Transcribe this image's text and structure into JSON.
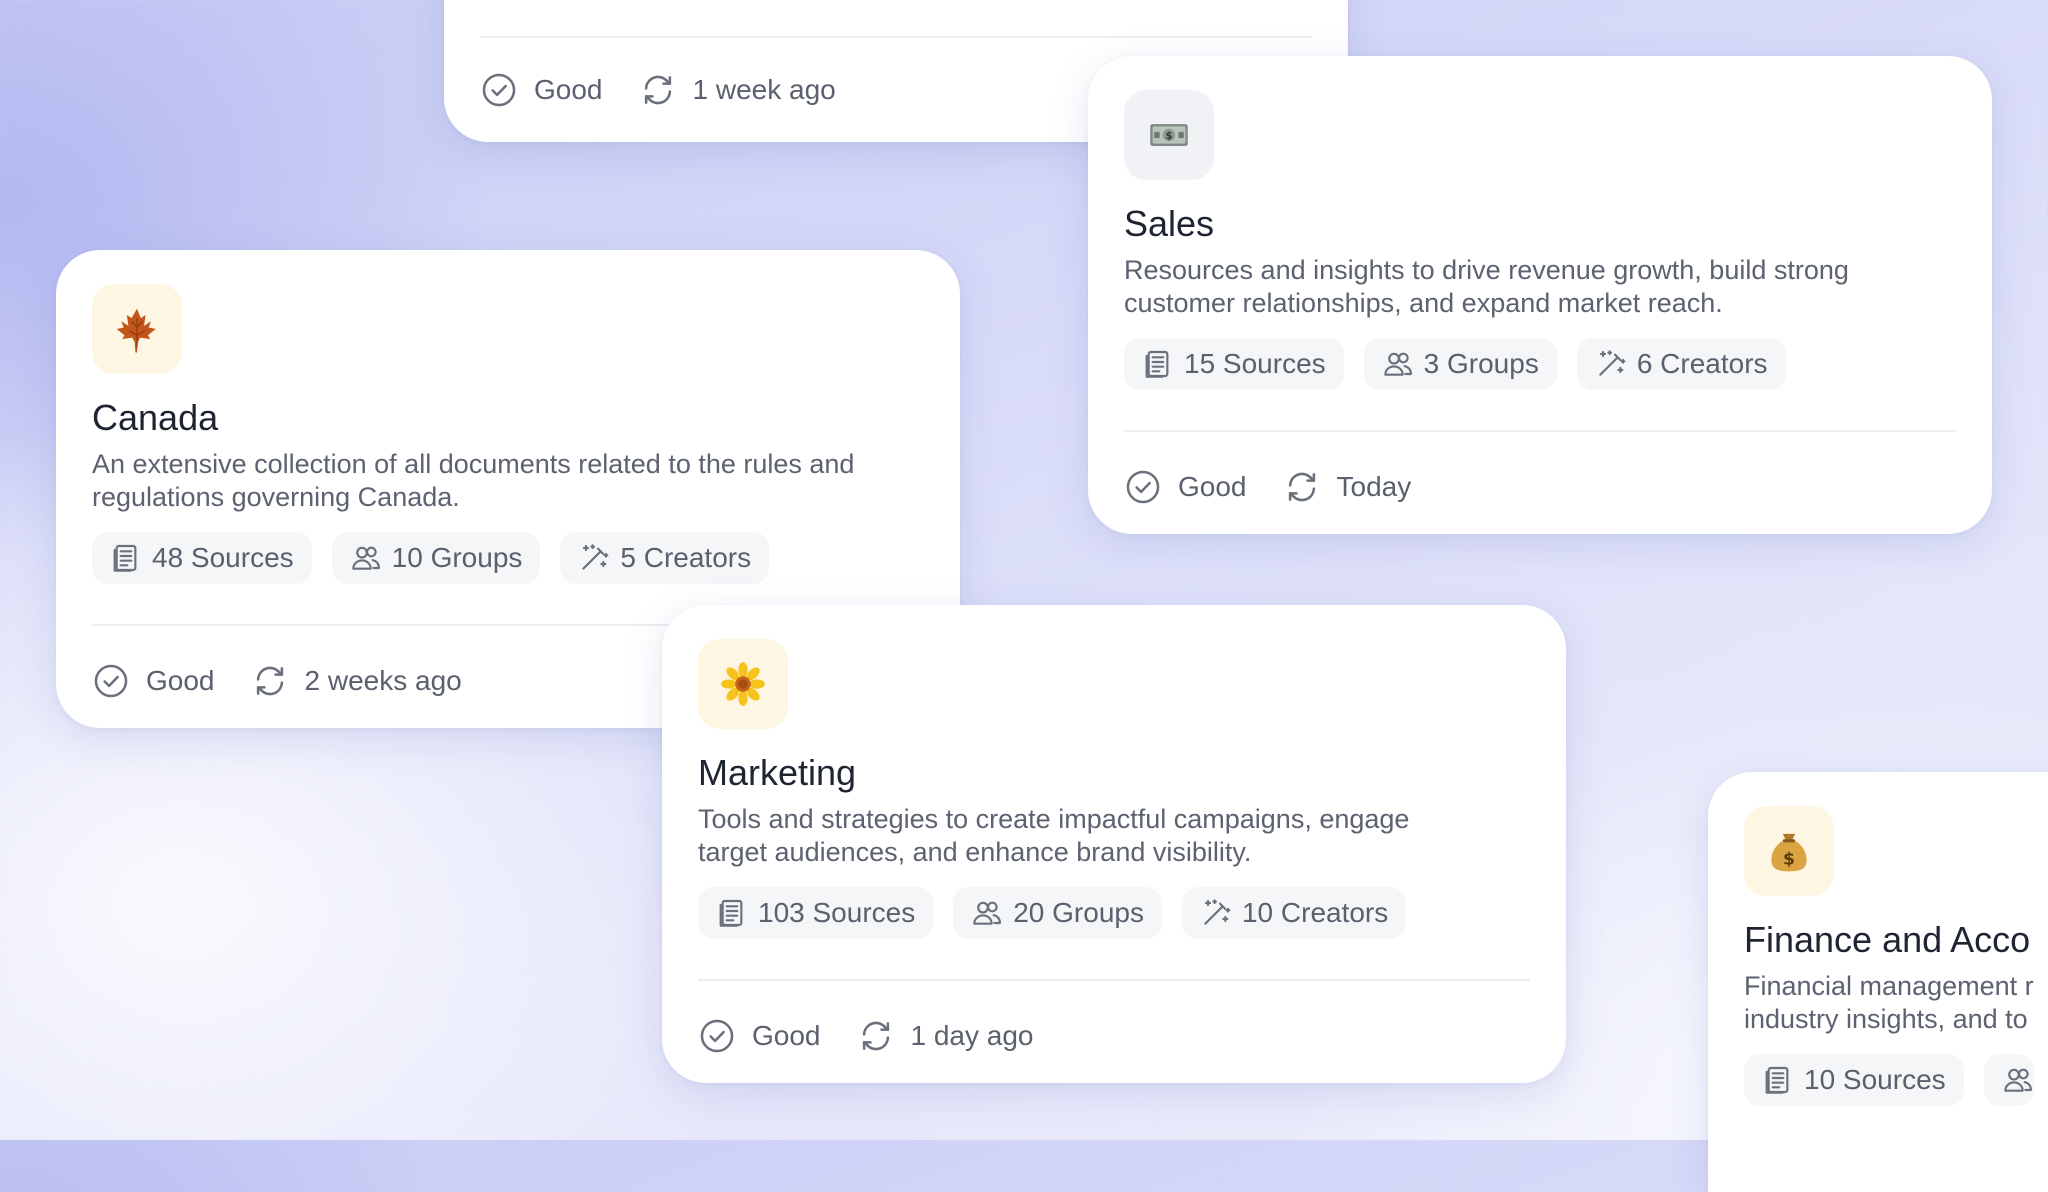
{
  "cards": {
    "top": {
      "status": "Good",
      "updated": "1 week ago"
    },
    "sales": {
      "title": "Sales",
      "desc_line1": "Resources and insights to drive revenue growth, build strong",
      "desc_line2": "customer relationships, and expand market reach.",
      "sources": "15 Sources",
      "groups": "3 Groups",
      "creators": "6 Creators",
      "status": "Good",
      "updated": "Today",
      "emoji": "money-bill-icon",
      "emoji_bg": "#f1f2f5"
    },
    "canada": {
      "title": "Canada",
      "desc_line1": "An extensive collection of all documents related to the rules and",
      "desc_line2": "regulations governing Canada.",
      "sources": "48 Sources",
      "groups": "10 Groups",
      "creators": "5 Creators",
      "status": "Good",
      "updated": "2 weeks ago",
      "emoji": "maple-leaf-icon",
      "emoji_bg": "#fdf6e3"
    },
    "marketing": {
      "title": "Marketing",
      "desc_line1": "Tools and strategies to create impactful campaigns, engage",
      "desc_line2": "target audiences, and enhance brand visibility.",
      "sources": "103 Sources",
      "groups": "20 Groups",
      "creators": "10 Creators",
      "status": "Good",
      "updated": "1 day ago",
      "emoji": "sunflower-icon",
      "emoji_bg": "#fdf6e3"
    },
    "finance": {
      "title": "Finance and Acco",
      "desc_line1": "Financial management r",
      "desc_line2": "industry insights, and to",
      "sources": "10 Sources",
      "emoji": "money-bag-icon",
      "emoji_bg": "#fdf6e3"
    }
  }
}
